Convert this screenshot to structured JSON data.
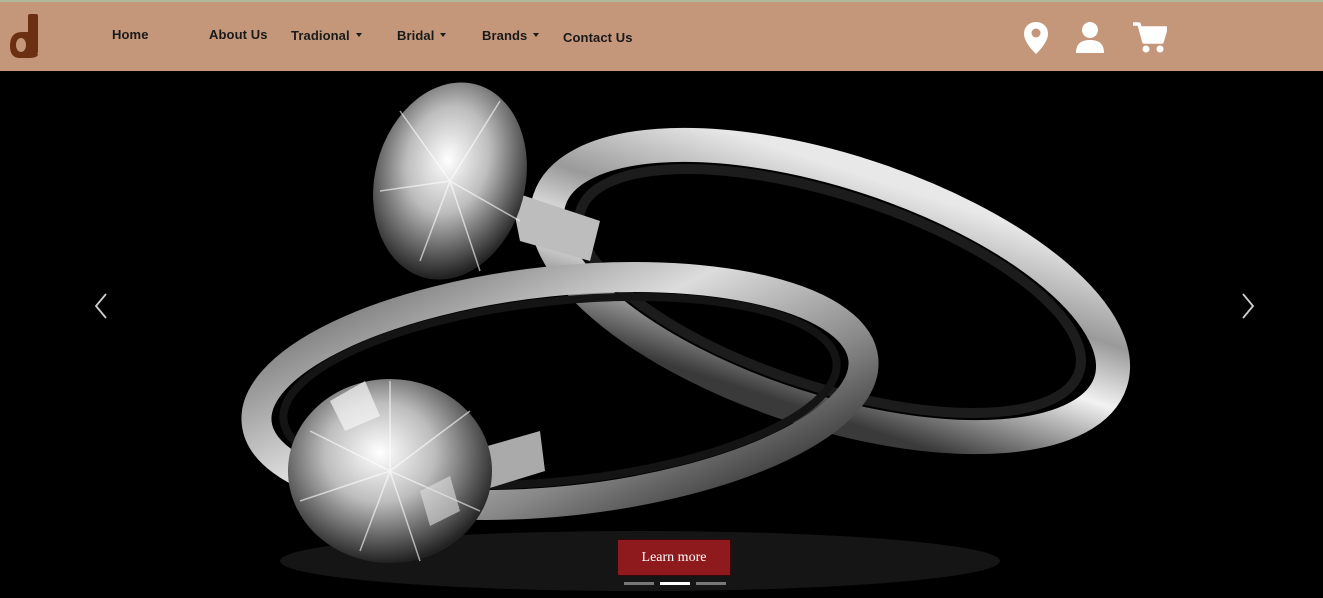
{
  "nav": {
    "items": [
      {
        "label": "Home",
        "dropdown": false
      },
      {
        "label": "About Us",
        "dropdown": false
      },
      {
        "label": "Tradional",
        "dropdown": true
      },
      {
        "label": "Bridal",
        "dropdown": true
      },
      {
        "label": "Brands",
        "dropdown": true
      },
      {
        "label": "Contact Us",
        "dropdown": false
      }
    ],
    "icons": [
      "location-pin-icon",
      "user-icon",
      "shopping-cart-icon"
    ]
  },
  "carousel": {
    "cta_label": "Learn more",
    "slide_count": 3,
    "active_slide": 2
  },
  "colors": {
    "navbar": "#c4967a",
    "logo": "#6b2f12",
    "cta": "#8e1a1d"
  }
}
